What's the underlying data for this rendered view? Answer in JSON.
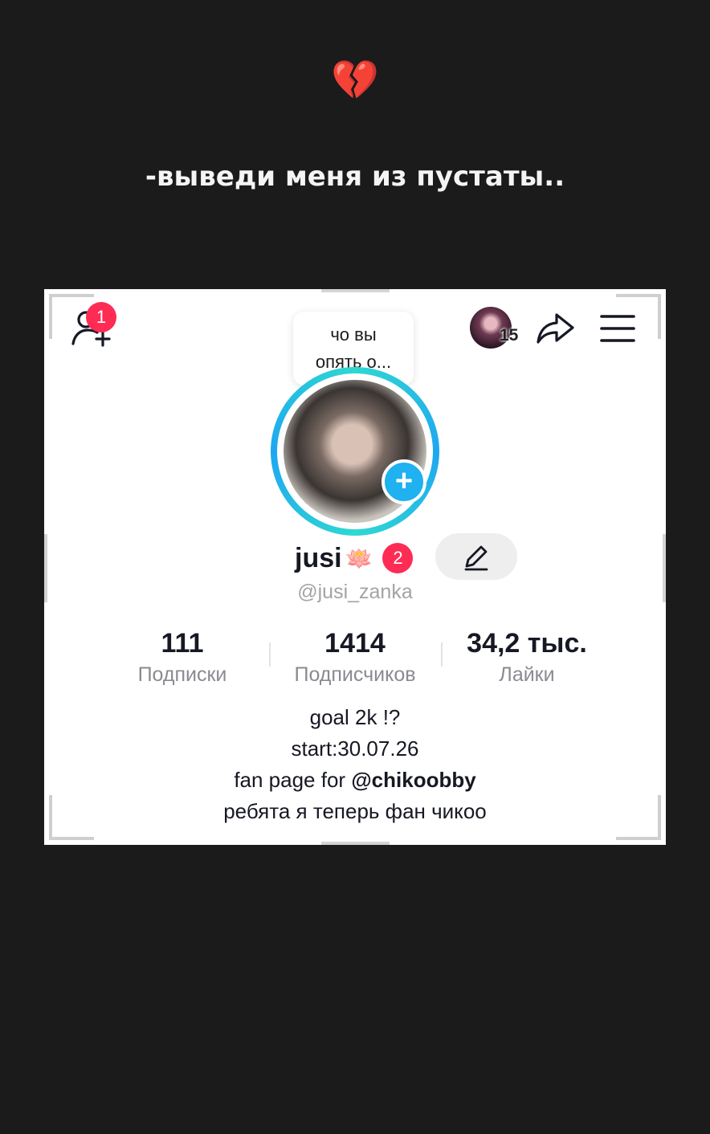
{
  "story": {
    "emoji": "💔",
    "caption": "-выведи меня из пустаты.."
  },
  "profile": {
    "notifications_badge": "1",
    "note_bubble_line1": "чо вы",
    "note_bubble_line2": "опять о...",
    "friends_count": "15",
    "display_name": "jusi",
    "name_emoji": "🪷",
    "name_badge": "2",
    "username": "@jusi_zanka",
    "stats": [
      {
        "value": "111",
        "label": "Подписки"
      },
      {
        "value": "1414",
        "label": "Подписчиков"
      },
      {
        "value": "34,2 тыс.",
        "label": "Лайки"
      }
    ],
    "bio": {
      "line1": "goal 2k !?",
      "line2": "start:30.07.26",
      "line3_prefix": "fan page for ",
      "line3_mention": "@chikoobby",
      "line4": "ребята я теперь фан чикоо"
    }
  },
  "colors": {
    "background": "#1b1b1b",
    "badge_red": "#fe2c55",
    "ring_cyan": "#2fd8d2",
    "ring_blue": "#1ea7f0",
    "plus_blue": "#1fb1f0"
  }
}
